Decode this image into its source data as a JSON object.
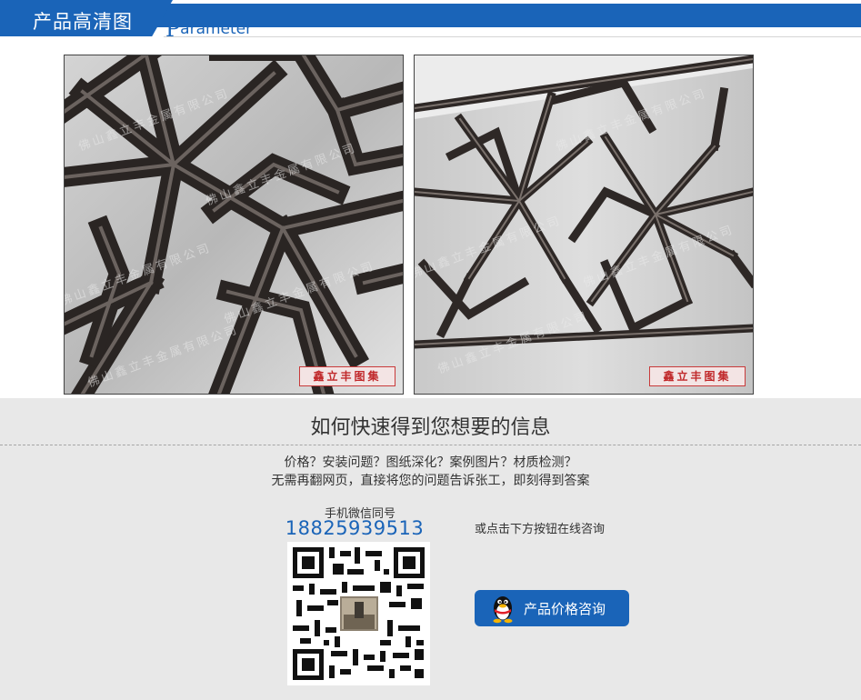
{
  "header": {
    "title": "产品高清图",
    "subtitle_initial": "P",
    "subtitle_rest": "arameter"
  },
  "photos": [
    {
      "stamp": "鑫立丰图集",
      "watermark": "佛山鑫立丰金属有限公司"
    },
    {
      "stamp": "鑫立丰图集",
      "watermark": "佛山鑫立丰金属有限公司"
    }
  ],
  "info": {
    "title": "如何快速得到您想要的信息",
    "questions_line1": "价格？安装问题？图纸深化？案例图片？材质检测？",
    "questions_line2": "无需再翻网页，直接将您的问题告诉张工，即刻得到答案",
    "wechat_label": "手机微信同号",
    "phone": "18825939513",
    "or_text": "或点击下方按钮在线咨询",
    "consult_button": "产品价格咨询"
  },
  "colors": {
    "brand_blue": "#1a64b8",
    "info_bg": "#e8e8e8",
    "stamp_red": "#c0282a"
  },
  "icons": {
    "qq": "qq-penguin-icon",
    "qr": "qr-code-image"
  }
}
